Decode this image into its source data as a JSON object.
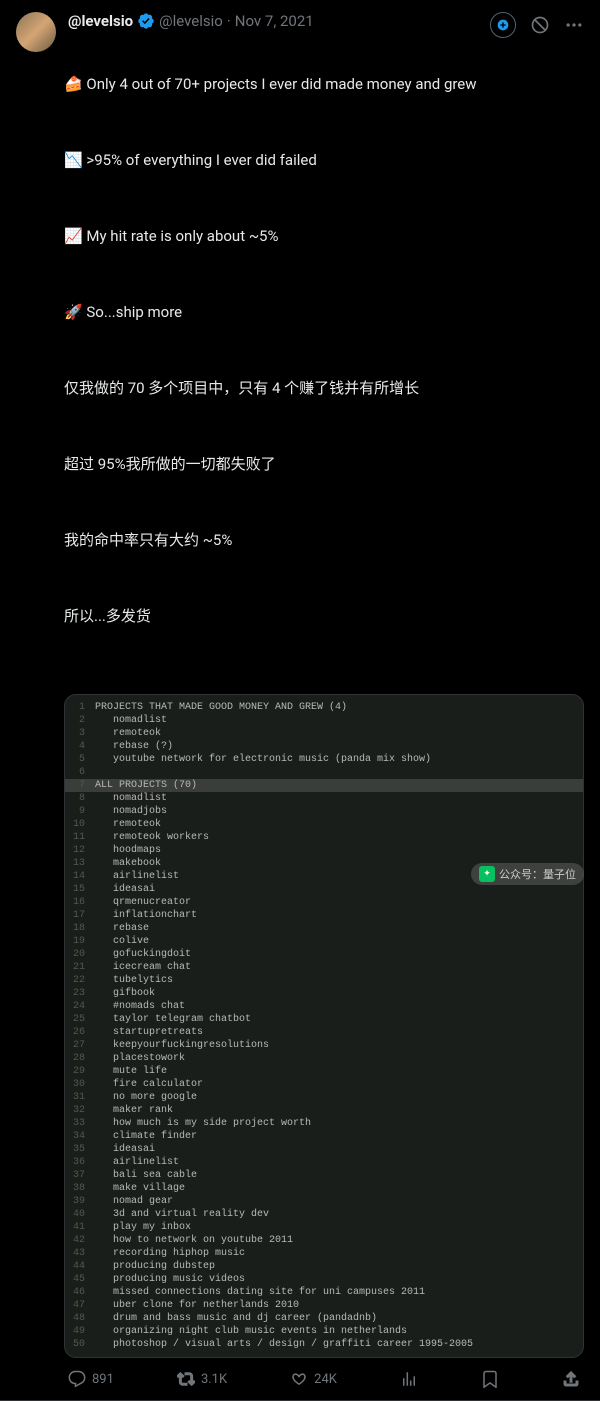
{
  "header": {
    "display_name": "@levelsio",
    "username": "@levelsio",
    "dot": "·",
    "timestamp": "Nov 7, 2021"
  },
  "tweet": {
    "line1": "🍰 Only 4 out of 70+ projects I ever did made money and grew",
    "line2": "📉 >95% of everything I ever did failed",
    "line3": "📈 My hit rate is only about ~5%",
    "line4": "🚀 So...ship more",
    "cn1": "仅我做的 70 多个项目中，只有 4 个赚了钱并有所增长",
    "cn2": "超过 95%我所做的一切都失败了",
    "cn3": "我的命中率只有大约 ~5%",
    "cn4": "所以...多发货"
  },
  "code": {
    "lines": [
      "PROJECTS THAT MADE GOOD MONEY AND GREW (4)",
      "   nomadlist",
      "   remoteok",
      "   rebase (?)",
      "   youtube network for electronic music (panda mix show)",
      "",
      "ALL PROJECTS (70)",
      "   nomadlist",
      "   nomadjobs",
      "   remoteok",
      "   remoteok workers",
      "   hoodmaps",
      "   makebook",
      "   airlinelist",
      "   ideasai",
      "   qrmenucreator",
      "   inflationchart",
      "   rebase",
      "   colive",
      "   gofuckingdoit",
      "   icecream chat",
      "   tubelytics",
      "   gifbook",
      "   #nomads chat",
      "   taylor telegram chatbot",
      "   startupretreats",
      "   keepyourfuckingresolutions",
      "   placestowork",
      "   mute life",
      "   fire calculator",
      "   no more google",
      "   maker rank",
      "   how much is my side project worth",
      "   climate finder",
      "   ideasai",
      "   airlinelist",
      "   bali sea cable",
      "   make village",
      "   nomad gear",
      "   3d and virtual reality dev",
      "   play my inbox",
      "   how to network on youtube 2011",
      "   recording hiphop music",
      "   producing dubstep",
      "   producing music videos",
      "   missed connections dating site for uni campuses 2011",
      "   uber clone for netherlands 2010",
      "   drum and bass music and dj career (pandadnb)",
      "   organizing night club music events in netherlands",
      "   photoshop / visual arts / design / graffiti career 1995-2005"
    ]
  },
  "actions": {
    "replies": "891",
    "retweets": "3.1K",
    "likes": "24K"
  },
  "wechat": {
    "label": "公众号：量子位"
  }
}
